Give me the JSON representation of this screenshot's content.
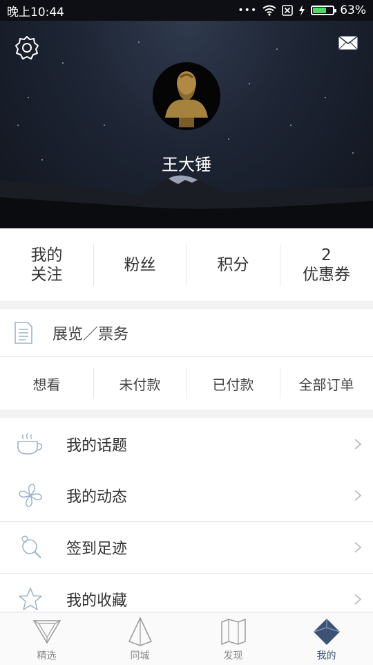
{
  "status_bar": {
    "time": "晚上10:44",
    "dots": "•••",
    "battery_percent_text": "63%",
    "battery_level": 0.63
  },
  "profile": {
    "username": "王大锤"
  },
  "stats": [
    {
      "line1": "我的",
      "line2": "关注"
    },
    {
      "line1": "粉丝",
      "line2": ""
    },
    {
      "line1": "积分",
      "line2": ""
    },
    {
      "line1": "2",
      "line2": "优惠券"
    }
  ],
  "tickets": {
    "title": "展览／票务",
    "orders": [
      "想看",
      "未付款",
      "已付款",
      "全部订单"
    ]
  },
  "menu": [
    {
      "label": "我的话题",
      "icon": "teacup-icon"
    },
    {
      "label": "我的动态",
      "icon": "pinwheel-icon"
    },
    {
      "label": "签到足迹",
      "icon": "location-search-icon"
    },
    {
      "label": "我的收藏",
      "icon": "star-icon"
    }
  ],
  "tabbar": [
    {
      "label": "精选",
      "icon": "triangle-icon",
      "active": false
    },
    {
      "label": "同城",
      "icon": "pyramid-icon",
      "active": false
    },
    {
      "label": "发现",
      "icon": "map-icon",
      "active": false
    },
    {
      "label": "我的",
      "icon": "diamond-icon",
      "active": true
    }
  ],
  "colors": {
    "accent": "#3d5275",
    "icon_line": "#9bb3cc",
    "divider": "#e6e6e6",
    "section_gap": "#f2f2f2"
  }
}
